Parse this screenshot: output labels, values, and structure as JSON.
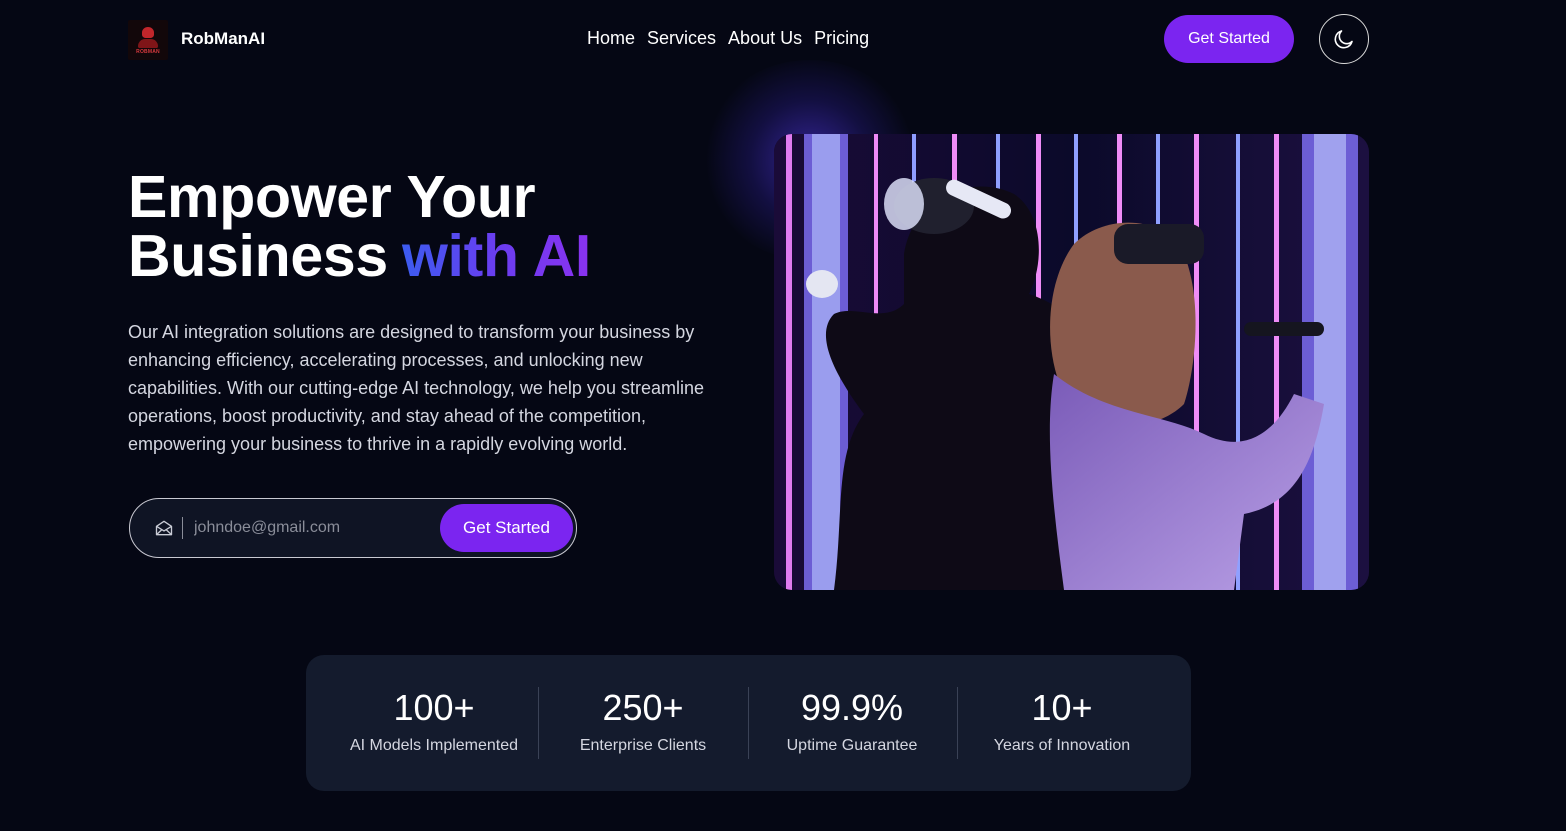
{
  "brand": {
    "name": "RobManAI",
    "logo_text": "ROBMAN"
  },
  "nav": {
    "items": [
      {
        "label": "Home"
      },
      {
        "label": "Services"
      },
      {
        "label": "About Us"
      },
      {
        "label": "Pricing"
      }
    ],
    "cta_label": "Get Started",
    "theme_toggle_icon": "moon-icon"
  },
  "hero": {
    "title_line1": "Empower Your",
    "title_line2": "Business",
    "title_accent": "with AI",
    "description": "Our AI integration solutions are designed to transform your business by enhancing efficiency, accelerating processes, and unlocking new capabilities. With our cutting-edge AI technology, we help you streamline operations, boost productivity, and stay ahead of the competition, empowering your business to thrive in a rapidly evolving world.",
    "email_placeholder": "johndoe@gmail.com",
    "email_value": "",
    "form_button_label": "Get Started",
    "form_icon": "mail-open-icon"
  },
  "stats": [
    {
      "value": "100+",
      "label": "AI Models Implemented"
    },
    {
      "value": "250+",
      "label": "Enterprise Clients"
    },
    {
      "value": "99.9%",
      "label": "Uptime Guarantee"
    },
    {
      "value": "10+",
      "label": "Years of Innovation"
    }
  ],
  "colors": {
    "background": "#050714",
    "accent": "#7b25f0",
    "accent_gradient_start": "#3c5cf0",
    "accent_gradient_end": "#8a32f0",
    "card": "#141b2d"
  }
}
